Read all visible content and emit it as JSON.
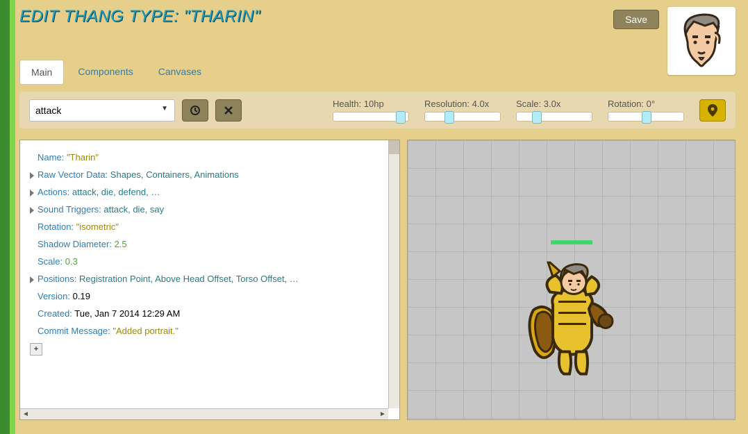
{
  "title": "EDIT THANG TYPE: \"THARIN\"",
  "save_label": "Save",
  "tabs": {
    "main": "Main",
    "components": "Components",
    "canvases": "Canvases"
  },
  "anim_dropdown": {
    "selected": "attack"
  },
  "sliders": {
    "health": {
      "label": "Health: 10hp",
      "pos": 90
    },
    "resolution": {
      "label": "Resolution: 4.0x",
      "pos": 28
    },
    "scale": {
      "label": "Scale: 3.0x",
      "pos": 22
    },
    "rotation": {
      "label": "Rotation: 0°",
      "pos": 48
    }
  },
  "tree": {
    "name": {
      "k": "Name",
      "v": "\"Tharin\""
    },
    "raw": {
      "k": "Raw Vector Data",
      "v": "Shapes, Containers, Animations"
    },
    "actions": {
      "k": "Actions",
      "v": "attack, die, defend, …"
    },
    "sound": {
      "k": "Sound Triggers",
      "v": "attack, die, say"
    },
    "rotation": {
      "k": "Rotation",
      "v": "\"isometric\""
    },
    "shadow": {
      "k": "Shadow Diameter",
      "v": "2.5"
    },
    "scale": {
      "k": "Scale",
      "v": "0.3"
    },
    "positions": {
      "k": "Positions",
      "v": "Registration Point, Above Head Offset, Torso Offset, …"
    },
    "version": {
      "k": "Version",
      "v": "0.19"
    },
    "created": {
      "k": "Created",
      "v": "Tue, Jan 7 2014 12:29 AM"
    },
    "commit": {
      "k": "Commit Message",
      "v": "\"Added portrait.\""
    }
  },
  "add_label": "+",
  "icons": {
    "history": "history-icon",
    "clear": "clear-icon",
    "pin": "pin-icon"
  }
}
